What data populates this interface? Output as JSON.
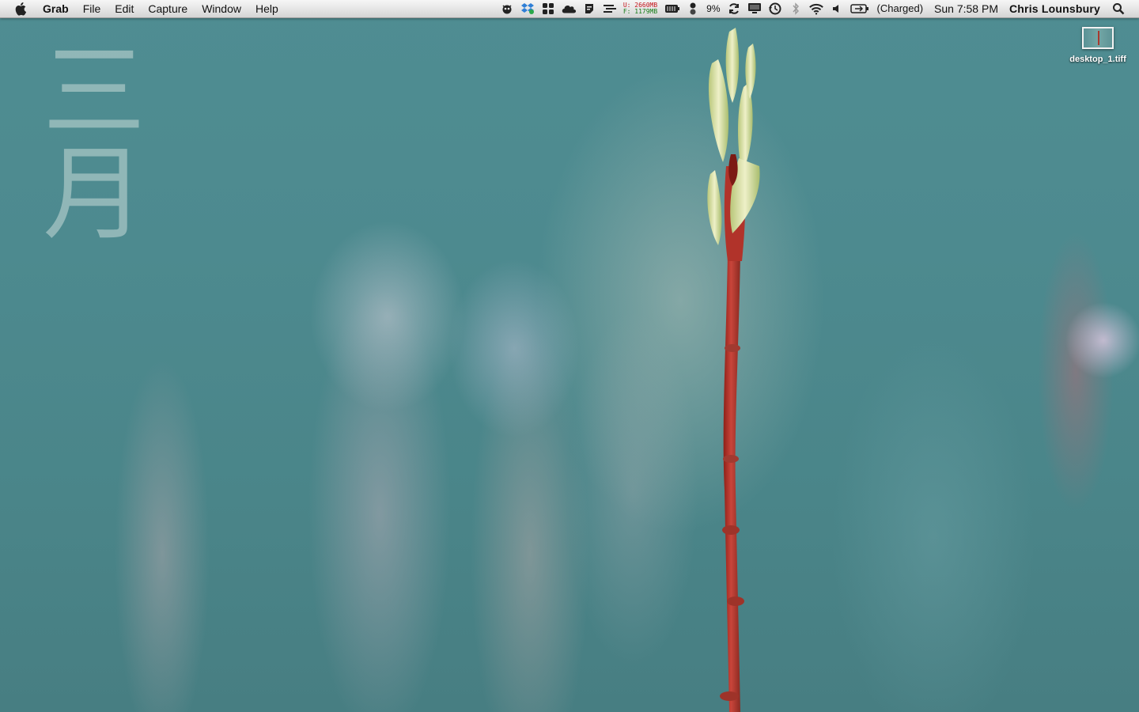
{
  "menubar": {
    "app_name": "Grab",
    "menus": [
      "File",
      "Edit",
      "Capture",
      "Window",
      "Help"
    ],
    "memory": {
      "used": "U: 2660MB",
      "free": "F: 1179MB"
    },
    "cpu": "9%",
    "battery_status": "(Charged)",
    "clock": "Sun 7:58 PM",
    "user": "Chris Lounsbury"
  },
  "desktop": {
    "calligraphy": "三月",
    "icons": [
      {
        "label": "desktop_1.tiff"
      }
    ]
  },
  "colors": {
    "menubar_top": "#f6f6f6",
    "menubar_bottom": "#d4d4d4",
    "wallpaper": "#4d8a8f",
    "memory_used": "#c4161c",
    "memory_free": "#137a14",
    "stem": "#b8322a",
    "bud": "#d9e2a8"
  },
  "status_icons": [
    "gremlin-icon",
    "dropbox-icon",
    "dashboard-icon",
    "cloud-icon",
    "evernote-icon",
    "sync-status-icon",
    "memory-meter",
    "cpu-meter-icon",
    "battery-gauge-icon",
    "sync-icon",
    "display-icon",
    "time-machine-icon",
    "bluetooth-icon",
    "wifi-icon",
    "volume-icon",
    "battery-icon",
    "spotlight-icon"
  ]
}
